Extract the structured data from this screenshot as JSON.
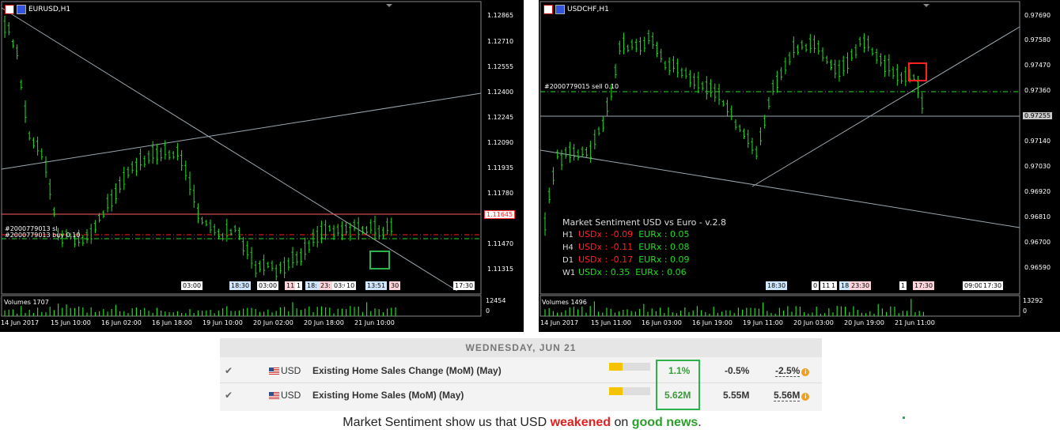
{
  "left_chart": {
    "title": "EURUSD,H1",
    "y_labels": [
      "1.12865",
      "1.12710",
      "1.12555",
      "1.12400",
      "1.12245",
      "1.12090",
      "1.11935",
      "1.11780",
      "1.11470",
      "1.11315"
    ],
    "current_price": "1.11645",
    "order_labels": [
      "#2000779013 sl",
      "#2000779013 buy 0.10"
    ],
    "session_tags": [
      "03:00",
      "18:30",
      "03:00",
      "11:",
      "1",
      "18:",
      "23:",
      "03:0",
      "10",
      "13:51",
      "30",
      "17:30"
    ],
    "volumes_label": "Volumes 1707",
    "vol_max": "12454",
    "vol_min": "0",
    "x_labels": [
      "14 Jun 2017",
      "15 Jun 10:00",
      "16 Jun 02:00",
      "16 Jun 18:00",
      "19 Jun 10:00",
      "20 Jun 02:00",
      "20 Jun 18:00",
      "21 Jun 10:00"
    ]
  },
  "right_chart": {
    "title": "USDCHF,H1",
    "y_labels": [
      "0.97690",
      "0.97580",
      "0.97470",
      "0.97360",
      "0.97140",
      "0.97030",
      "0.96920",
      "0.96810",
      "0.96700",
      "0.96590"
    ],
    "current_price": "0.97255",
    "order_label": "#2000779015 sell 0.10",
    "session_tags": [
      "18:30",
      "0",
      "11",
      "1",
      "18",
      "23:30",
      "1",
      "17:30",
      "09:00",
      "17:30"
    ],
    "volumes_label": "Volumes 1496",
    "vol_max": "13292",
    "vol_min": "0",
    "x_labels": [
      "14 Jun 2017",
      "15 Jun 11:00",
      "16 Jun 03:00",
      "16 Jun 19:00",
      "19 Jun 11:00",
      "20 Jun 03:00",
      "20 Jun 19:00",
      "21 Jun 11:00"
    ]
  },
  "sentiment": {
    "title": "Market Sentiment USD vs Euro - v.2.8",
    "rows": [
      {
        "tf": "H1",
        "usd": "USDx : -0.09",
        "eur": "EURx : 0.05",
        "usd_color": "#ff2020",
        "eur_color": "#22dd22"
      },
      {
        "tf": "H4",
        "usd": "USDx : -0.11",
        "eur": "EURx : 0.08",
        "usd_color": "#ff2020",
        "eur_color": "#22dd22"
      },
      {
        "tf": "D1",
        "usd": "USDx : -0.17",
        "eur": "EURx : 0.09",
        "usd_color": "#ff2020",
        "eur_color": "#22dd22"
      },
      {
        "tf": "W1",
        "usd": "USDx : 0.35",
        "eur": "EURx : 0.06",
        "usd_color": "#22dd22",
        "eur_color": "#22dd22"
      }
    ]
  },
  "calendar": {
    "date_header": "WEDNESDAY, JUN 21",
    "rows": [
      {
        "check": "✔",
        "currency": "USD",
        "event": "Existing Home Sales Change (MoM) (May)",
        "importance": 0.33,
        "actual": "1.1%",
        "forecast": "-0.5%",
        "previous": "-2.5%"
      },
      {
        "check": "✔",
        "currency": "USD",
        "event": "Existing Home Sales (MoM) (May)",
        "importance": 0.33,
        "actual": "5.62M",
        "forecast": "5.55M",
        "previous": "5.56M"
      }
    ]
  },
  "caption": {
    "prefix": "Market Sentiment show us that USD ",
    "weak": "weakened",
    "mid": " on ",
    "good": "good news",
    "suffix": "."
  },
  "colors": {
    "bull": "#22dd22",
    "bear": "#ff2020",
    "highlight": "#2cb24b",
    "box_red": "#ff2020"
  }
}
